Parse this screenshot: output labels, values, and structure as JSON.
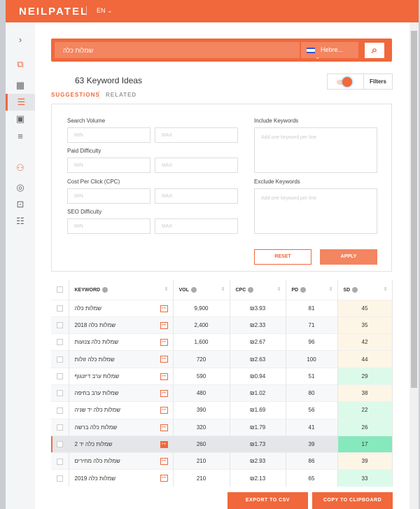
{
  "header": {
    "logo": "NEILPATEL",
    "lang": "EN ⌄"
  },
  "search": {
    "value": "שמלות כלה",
    "language": "Hebre...",
    "chevron": "⌄"
  },
  "results": {
    "count": "63 Keyword Ideas"
  },
  "tabs": [
    {
      "label": "SUGGESTIONS",
      "active": true
    },
    {
      "label": "RELATED",
      "active": false
    }
  ],
  "filters_button": "Filters",
  "filters": {
    "search_volume": "Search Volume",
    "paid_difficulty": "Paid Difficulty",
    "cpc": "Cost Per Click (CPC)",
    "seo_difficulty": "SEO Difficulty",
    "min": "MIN",
    "max": "MAX",
    "include": "Include Keywords",
    "exclude": "Exclude Keywords",
    "textarea_placeholder": "Add one keyword per line",
    "reset": "RESET",
    "apply": "APPLY"
  },
  "table": {
    "headers": [
      "KEYWORD",
      "VOL",
      "CPC",
      "PD",
      "SD"
    ],
    "rows": [
      {
        "keyword": "שמלות כלה",
        "vol": "9,900",
        "cpc": "₪3.93",
        "pd": "81",
        "sd": "45",
        "sd_color": "#fdf5e6"
      },
      {
        "keyword": "שמלות כלה 2018",
        "vol": "2,400",
        "cpc": "₪2.33",
        "pd": "71",
        "sd": "35",
        "sd_color": "#fdf5e6"
      },
      {
        "keyword": "שמלות כלה צנועות",
        "vol": "1,600",
        "cpc": "₪2.67",
        "pd": "96",
        "sd": "42",
        "sd_color": "#fdf5e6"
      },
      {
        "keyword": "שמלות כלה זולות",
        "vol": "720",
        "cpc": "₪2.63",
        "pd": "100",
        "sd": "44",
        "sd_color": "#fdf5e6"
      },
      {
        "keyword": "שמלות ערב דיזנגוף",
        "vol": "590",
        "cpc": "₪0.94",
        "pd": "51",
        "sd": "29",
        "sd_color": "#dcfaea"
      },
      {
        "keyword": "שמלות ערב בחיפה",
        "vol": "480",
        "cpc": "₪1.02",
        "pd": "80",
        "sd": "38",
        "sd_color": "#fdf5e6"
      },
      {
        "keyword": "שמלות כלה יד שניה",
        "vol": "390",
        "cpc": "₪1.69",
        "pd": "56",
        "sd": "22",
        "sd_color": "#dcfaea"
      },
      {
        "keyword": "שמלות כלה ברשה",
        "vol": "320",
        "cpc": "₪1.79",
        "pd": "41",
        "sd": "26",
        "sd_color": "#dcfaea"
      },
      {
        "keyword": "שמלות כלה יד 2",
        "vol": "260",
        "cpc": "₪1.73",
        "pd": "39",
        "sd": "17",
        "sd_color": "#86e8bd"
      },
      {
        "keyword": "שמלות כלה מחירים",
        "vol": "210",
        "cpc": "₪2.93",
        "pd": "86",
        "sd": "39",
        "sd_color": "#fdf5e6"
      },
      {
        "keyword": "שמלות כלה 2019",
        "vol": "210",
        "cpc": "₪2.13",
        "pd": "65",
        "sd": "33",
        "sd_color": "#dcfaea"
      }
    ]
  },
  "actions": {
    "export": "EXPORT TO CSV",
    "copy": "COPY TO CLIPBOARD"
  },
  "colors": {
    "accent": "#f0683b"
  }
}
